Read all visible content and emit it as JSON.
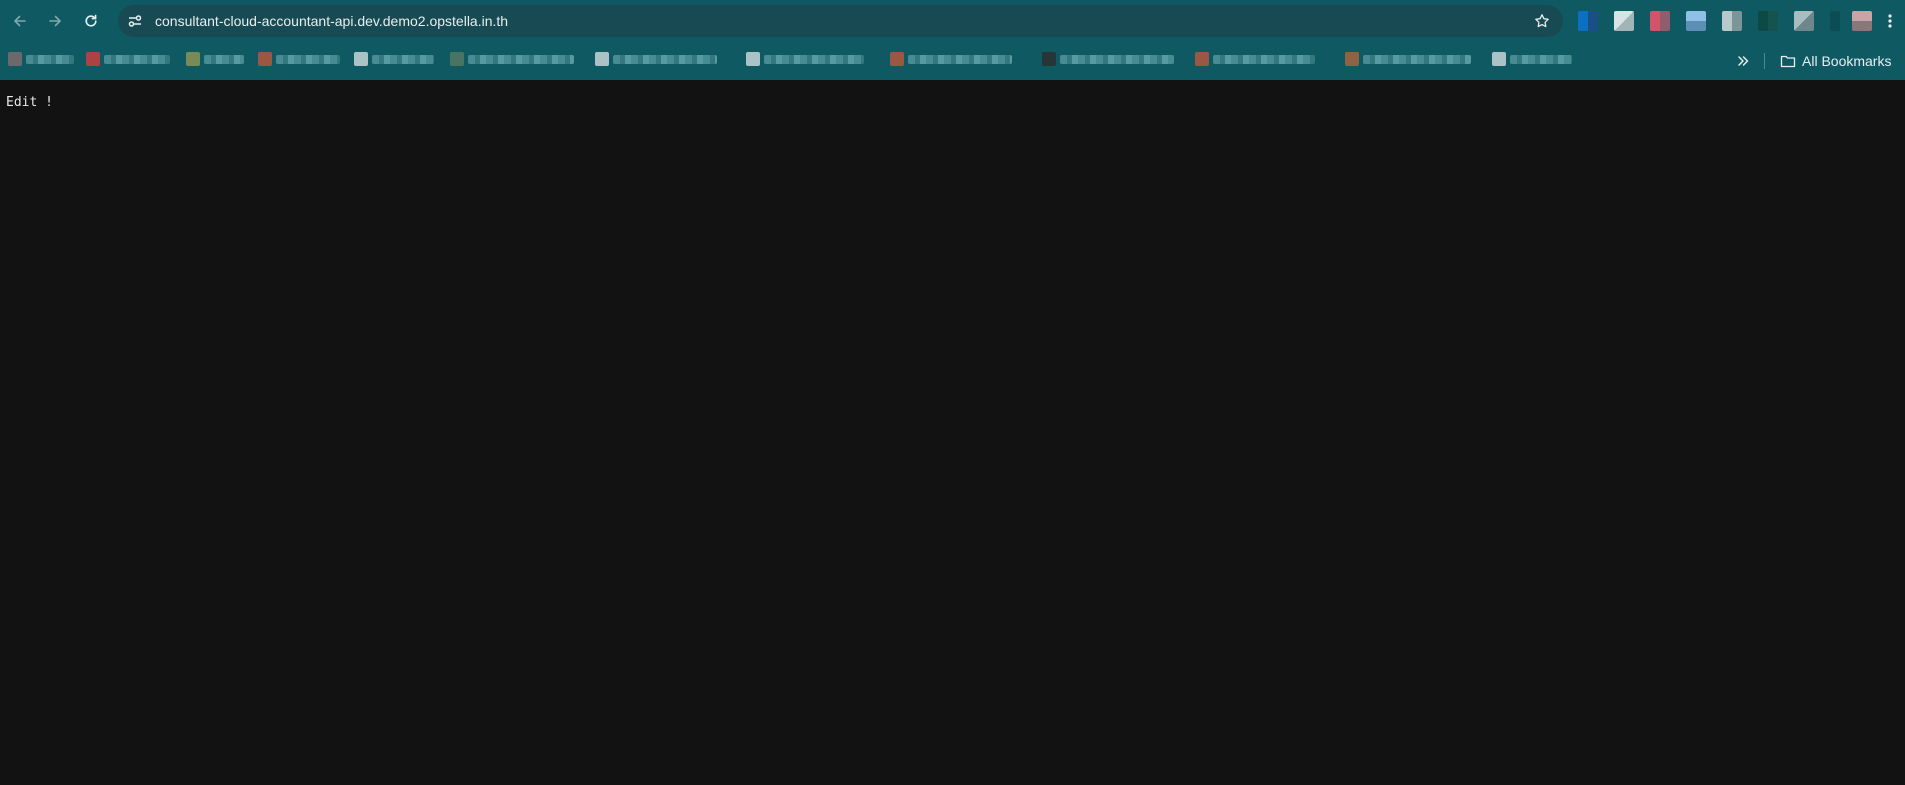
{
  "browser": {
    "url": "consultant-cloud-accountant-api.dev.demo2.opstella.in.th",
    "nav": [
      "back-icon",
      "forward-icon",
      "reload-icon"
    ],
    "site_info_icon": "tune-icon",
    "bookmark_star_icon": "star-icon",
    "menu_icon": "kebab-menu-icon",
    "colors": {
      "toolbar": "#0f5a62",
      "omnibox": "#174a52",
      "page_background": "#121212",
      "text": "#e6eef0"
    }
  },
  "bookmarks_bar": {
    "overflow_icon": "double-chevron-right-icon",
    "all_bookmarks_icon": "folder-icon",
    "all_bookmarks_label": "All Bookmarks"
  },
  "page": {
    "body_text": "Edit !"
  }
}
